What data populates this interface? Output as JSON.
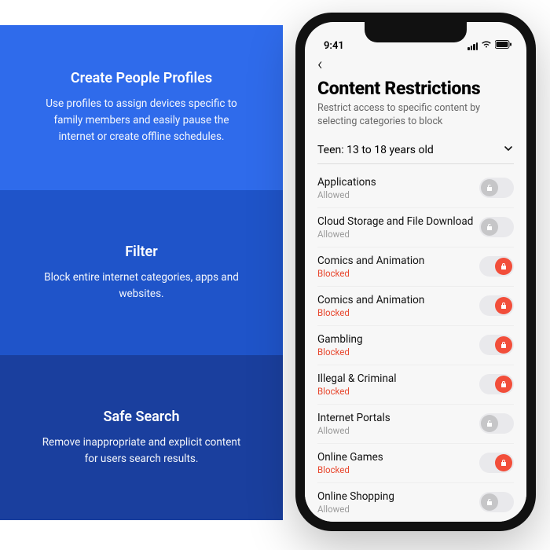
{
  "panels": [
    {
      "title": "Create People Profiles",
      "body": "Use profiles to assign devices specific to family members  and easily pause the internet or create offline schedules."
    },
    {
      "title": "Filter",
      "body": "Block entire internet categories, apps and websites."
    },
    {
      "title": "Safe Search",
      "body": "Remove inappropriate and explicit content for users search results."
    }
  ],
  "phone": {
    "status_time": "9:41",
    "back_glyph": "‹",
    "page_title": "Content Restrictions",
    "page_subtitle": "Restrict access to specific content by selecting categories to block",
    "selector_label": "Teen: 13 to 18 years old",
    "state_allowed": "Allowed",
    "state_blocked": "Blocked",
    "rows": [
      {
        "label": "Applications",
        "blocked": false
      },
      {
        "label": "Cloud Storage and File Download",
        "blocked": false
      },
      {
        "label": "Comics and Animation",
        "blocked": true
      },
      {
        "label": "Comics and Animation",
        "blocked": true
      },
      {
        "label": "Gambling",
        "blocked": true
      },
      {
        "label": "Illegal & Criminal",
        "blocked": true
      },
      {
        "label": "Internet Portals",
        "blocked": false
      },
      {
        "label": "Online Games",
        "blocked": true
      },
      {
        "label": "Online Shopping",
        "blocked": false
      }
    ]
  },
  "colors": {
    "blocked": "#e8482f",
    "allowed": "#9a9a9a",
    "toggle_on": "#f24e3a",
    "toggle_off": "#c6c6c8"
  }
}
